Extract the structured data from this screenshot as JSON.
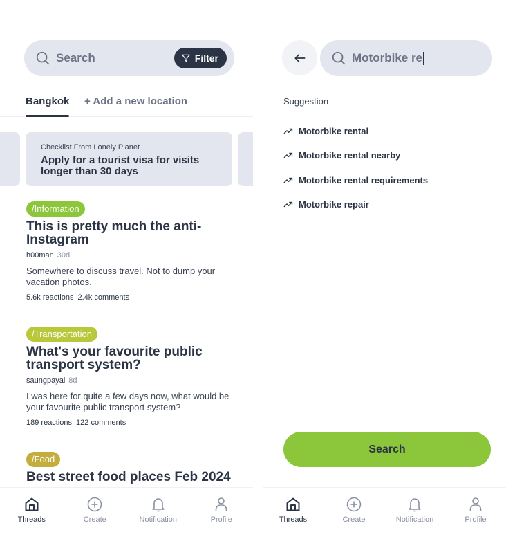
{
  "colors": {
    "tag_information": "#8cc63a",
    "tag_transportation": "#b9c73a",
    "tag_food": "#c4ad3c",
    "primary_dark": "#2b3445",
    "search_button": "#8cc63a"
  },
  "left": {
    "search": {
      "placeholder": "Search",
      "filter_label": "Filter"
    },
    "tabs": {
      "active": "Bangkok",
      "add": "+ Add a new location"
    },
    "card": {
      "eyebrow": "Checklist From Lonely Planet",
      "title": "Apply for a tourist visa for visits longer than 30 days"
    },
    "posts": [
      {
        "tag": "/Information",
        "title": "This is pretty much the anti-Instagram",
        "author": "h00man",
        "age": "30d",
        "body": "Somewhere to discuss travel. Not to dump your vacation photos.",
        "reactions": "5.6k reactions",
        "comments": "2.4k comments"
      },
      {
        "tag": "/Transportation",
        "title": "What's your favourite public transport system?",
        "author": "saungpayal",
        "age": "8d",
        "body": "I was here for quite a few days now, what would be your favourite public transport system?",
        "reactions": "189 reactions",
        "comments": "122 comments"
      },
      {
        "tag": "/Food",
        "title": "Best street food places Feb 2024"
      }
    ]
  },
  "right": {
    "search": {
      "query": "Motorbike re"
    },
    "suggestion_heading": "Suggestion",
    "suggestions": [
      "Motorbike rental",
      "Motorbike rental nearby",
      "Motorbike rental requirements",
      "Motorbike repair"
    ],
    "search_button": "Search"
  },
  "nav": [
    {
      "label": "Threads",
      "icon": "home-icon",
      "active": true
    },
    {
      "label": "Create",
      "icon": "plus-circle-icon",
      "active": false
    },
    {
      "label": "Notification",
      "icon": "bell-icon",
      "active": false
    },
    {
      "label": "Profile",
      "icon": "user-icon",
      "active": false
    }
  ]
}
